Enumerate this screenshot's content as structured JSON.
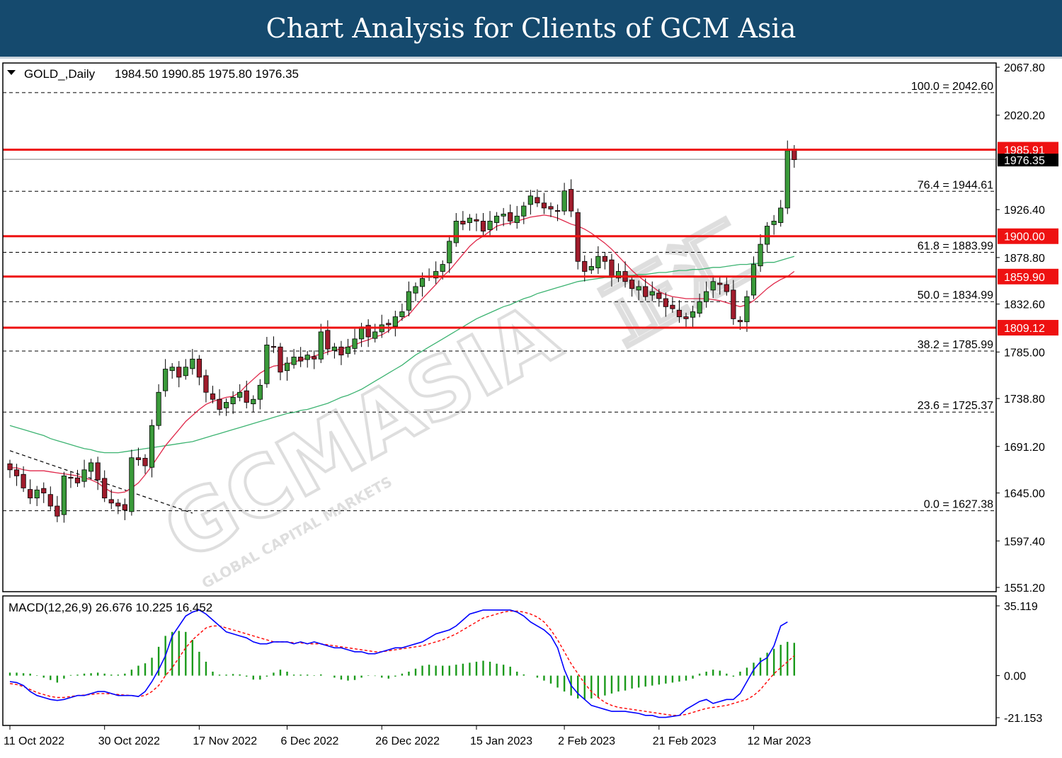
{
  "banner": {
    "title": "Chart Analysis for Clients of GCM Asia"
  },
  "header": {
    "symbol": "GOLD_,Daily",
    "ohlc": "1984.50 1990.85 1975.80 1976.35"
  },
  "watermark": {
    "main": "GCMASIA",
    "cn": "正汇",
    "sub": "GLOBAL CAPITAL MARKETS"
  },
  "colors": {
    "up_candle": "#3a9a3a",
    "down_candle": "#a01c2c",
    "resistance": "#ee1111",
    "ma_fast": "#e0284a",
    "ma_slow": "#3cb371",
    "macd": "#0000ff",
    "signal": "#ff0000",
    "histogram": "#1a9a1a",
    "label_bg_red": "#ee1111",
    "label_bg_black": "#000000"
  },
  "chart_data": [
    {
      "type": "line",
      "subtype": "candlestick",
      "ylim": [
        1551.2,
        2067.8
      ],
      "yticks": [
        "2067.80",
        "2020.20",
        "1926.40",
        "1878.80",
        "1832.60",
        "1785.00",
        "1738.80",
        "1691.20",
        "1645.00",
        "1597.40",
        "1551.20"
      ],
      "x_ticks": [
        "11 Oct 2022",
        "30 Oct 2022",
        "17 Nov 2022",
        "6 Dec 2022",
        "26 Dec 2022",
        "15 Jan 2023",
        "2 Feb 2023",
        "21 Feb 2023",
        "12 Mar 2023"
      ],
      "x_tick_index": [
        0,
        14,
        28,
        41,
        55,
        69,
        82,
        96,
        110
      ],
      "current_price": "1976.35",
      "resistance_levels": [
        {
          "value": 1985.91,
          "label": "1985.91"
        },
        {
          "value": 1900.0,
          "label": "1900.00"
        },
        {
          "value": 1859.9,
          "label": "1859.90"
        },
        {
          "value": 1809.12,
          "label": "1809.12"
        }
      ],
      "fibonacci": [
        {
          "value": 2042.6,
          "label": "100.0 = 2042.60"
        },
        {
          "value": 1944.61,
          "label": "76.4 = 1944.61"
        },
        {
          "value": 1883.99,
          "label": "61.8 = 1883.99"
        },
        {
          "value": 1834.99,
          "label": "50.0 = 1834.99"
        },
        {
          "value": 1785.99,
          "label": "38.2 = 1785.99"
        },
        {
          "value": 1725.37,
          "label": "23.6 = 1725.37"
        },
        {
          "value": 1627.38,
          "label": "0.0 = 1627.38"
        }
      ],
      "trendline": [
        [
          0,
          1687
        ],
        [
          27,
          1625
        ]
      ],
      "close": [
        1668,
        1662,
        1650,
        1640,
        1648,
        1645,
        1632,
        1622,
        1662,
        1660,
        1655,
        1668,
        1675,
        1658,
        1640,
        1635,
        1632,
        1628,
        1680,
        1678,
        1672,
        1712,
        1745,
        1768,
        1770,
        1760,
        1770,
        1778,
        1760,
        1745,
        1738,
        1728,
        1735,
        1740,
        1745,
        1735,
        1738,
        1752,
        1792,
        1790,
        1765,
        1774,
        1780,
        1776,
        1782,
        1778,
        1805,
        1788,
        1790,
        1782,
        1790,
        1798,
        1810,
        1800,
        1805,
        1812,
        1812,
        1820,
        1825,
        1845,
        1850,
        1858,
        1860,
        1865,
        1872,
        1895,
        1915,
        1912,
        1918,
        1915,
        1905,
        1915,
        1920,
        1922,
        1915,
        1920,
        1930,
        1940,
        1933,
        1928,
        1927,
        1925,
        1945,
        1925,
        1875,
        1865,
        1870,
        1880,
        1875,
        1860,
        1865,
        1855,
        1848,
        1850,
        1840,
        1845,
        1838,
        1830,
        1828,
        1820,
        1818,
        1825,
        1835,
        1845,
        1855,
        1852,
        1845,
        1818,
        1815,
        1840,
        1872,
        1892,
        1910,
        1915,
        1928,
        1985,
        1976
      ],
      "ma_fast": [
        1670,
        1670,
        1668,
        1667,
        1667,
        1667,
        1666,
        1665,
        1664,
        1663,
        1662,
        1660,
        1658,
        1655,
        1650,
        1646,
        1645,
        1646,
        1650,
        1655,
        1663,
        1672,
        1682,
        1692,
        1700,
        1708,
        1716,
        1722,
        1728,
        1733,
        1736,
        1738,
        1740,
        1741,
        1745,
        1752,
        1758,
        1764,
        1768,
        1771,
        1772,
        1773,
        1775,
        1777,
        1779,
        1781,
        1783,
        1785,
        1787,
        1788,
        1790,
        1792,
        1795,
        1797,
        1800,
        1802,
        1806,
        1812,
        1818,
        1822,
        1830,
        1838,
        1845,
        1852,
        1860,
        1866,
        1874,
        1882,
        1890,
        1896,
        1900,
        1905,
        1910,
        1912,
        1913,
        1915,
        1917,
        1919,
        1920,
        1921,
        1920,
        1918,
        1915,
        1912,
        1910,
        1907,
        1903,
        1898,
        1893,
        1887,
        1880,
        1873,
        1866,
        1860,
        1855,
        1850,
        1845,
        1842,
        1840,
        1839,
        1838,
        1838,
        1838,
        1838,
        1837,
        1836,
        1834,
        1832,
        1830,
        1832,
        1836,
        1842,
        1848,
        1853,
        1857,
        1860,
        1865
      ],
      "ma_slow": [
        1712,
        1710,
        1708,
        1706,
        1704,
        1702,
        1699,
        1697,
        1695,
        1693,
        1691,
        1689,
        1688,
        1686,
        1685,
        1685,
        1685,
        1686,
        1687,
        1688,
        1689,
        1690,
        1691,
        1692,
        1693,
        1694,
        1695,
        1696,
        1698,
        1700,
        1702,
        1704,
        1706,
        1708,
        1710,
        1712,
        1714,
        1716,
        1718,
        1720,
        1722,
        1724,
        1725,
        1727,
        1728,
        1730,
        1732,
        1734,
        1737,
        1740,
        1742,
        1745,
        1748,
        1752,
        1756,
        1760,
        1764,
        1768,
        1772,
        1777,
        1782,
        1786,
        1790,
        1794,
        1798,
        1802,
        1806,
        1810,
        1814,
        1818,
        1821,
        1824,
        1827,
        1830,
        1832,
        1835,
        1838,
        1840,
        1843,
        1845,
        1847,
        1849,
        1851,
        1853,
        1855,
        1856,
        1857,
        1858,
        1859,
        1859,
        1860,
        1861,
        1861,
        1862,
        1862,
        1863,
        1864,
        1864,
        1865,
        1866,
        1866,
        1867,
        1867,
        1868,
        1869,
        1869,
        1870,
        1871,
        1872,
        1872,
        1873,
        1873,
        1874,
        1874,
        1876,
        1878,
        1880
      ]
    },
    {
      "type": "line",
      "title": "MACD(12,26,9) 26.676 10.225 16.452",
      "ylim": [
        -21.153,
        35.119
      ],
      "yticks": [
        "35.119",
        "0.00",
        "-21.153"
      ],
      "histogram": [
        1.5,
        1.5,
        1.2,
        1.0,
        0.2,
        -1.0,
        -2.2,
        -3.5,
        -1.5,
        0.3,
        0.5,
        1.0,
        1.2,
        1.5,
        1.0,
        0.5,
        0.5,
        1.0,
        3.0,
        5.0,
        6.2,
        9.0,
        14.5,
        20.0,
        22.0,
        22.5,
        22.0,
        18.0,
        12.0,
        7.0,
        2.0,
        0.5,
        0.5,
        0.8,
        0.6,
        -0.5,
        -2.0,
        -2.0,
        -0.5,
        1.5,
        3.0,
        2.0,
        0.5,
        0.5,
        0.5,
        0.2,
        0.6,
        0.0,
        -1.0,
        -2.0,
        -2.5,
        -2.2,
        -1.0,
        0.2,
        -0.2,
        -1.0,
        -1.5,
        -0.5,
        1.0,
        2.0,
        3.5,
        5.0,
        5.5,
        5.0,
        5.0,
        5.0,
        5.5,
        6.0,
        6.5,
        7.0,
        7.5,
        7.0,
        6.0,
        5.5,
        4.5,
        2.0,
        0.6,
        0.0,
        -1.0,
        -2.5,
        -4.0,
        -6.0,
        -8.0,
        -10.0,
        -11.5,
        -12.0,
        -11.5,
        -11.0,
        -10.0,
        -9.0,
        -8.0,
        -7.5,
        -6.5,
        -6.0,
        -5.5,
        -5.0,
        -4.5,
        -4.0,
        -3.5,
        -3.0,
        -2.5,
        -1.5,
        1.0,
        2.0,
        3.0,
        2.5,
        1.0,
        -0.5,
        2.0,
        4.0,
        6.5,
        9.0,
        11.5,
        13.5,
        15.5,
        17.0,
        16.5
      ],
      "macd": [
        -3,
        -3.5,
        -5,
        -8,
        -10,
        -11,
        -12,
        -12.5,
        -12,
        -11,
        -10,
        -10,
        -9,
        -8,
        -8,
        -9,
        -10,
        -10,
        -10,
        -10.5,
        -8,
        -3,
        3,
        10,
        20,
        25,
        30,
        32,
        33,
        31,
        28,
        25,
        22,
        21,
        20,
        19,
        17,
        16,
        16,
        17,
        17,
        17,
        16,
        17,
        16,
        17,
        16,
        15,
        14,
        14,
        13,
        12,
        12,
        11,
        11,
        12,
        13,
        14,
        14,
        15,
        16,
        17,
        19,
        21,
        22,
        23,
        25,
        28,
        31,
        32,
        33,
        33,
        33,
        33,
        33,
        32,
        30,
        27,
        25,
        23,
        20,
        14,
        3,
        -5,
        -9,
        -12,
        -15,
        -16,
        -17,
        -18,
        -18,
        -18,
        -18.5,
        -19,
        -20,
        -20,
        -21,
        -21,
        -20.5,
        -20,
        -17,
        -15,
        -13,
        -12,
        -14,
        -13,
        -12,
        -12,
        -9,
        -3,
        3,
        7,
        9,
        15,
        25,
        27
      ],
      "signal": [
        -4,
        -4.5,
        -5.5,
        -7,
        -8.5,
        -9.5,
        -10.5,
        -11,
        -11,
        -10.5,
        -10,
        -9.8,
        -9.5,
        -9,
        -9,
        -9.2,
        -9.5,
        -9.8,
        -10,
        -10.5,
        -10,
        -8,
        -5,
        0,
        4,
        9,
        14,
        18,
        21,
        24,
        25,
        25,
        24,
        23,
        22,
        21,
        20,
        19,
        18,
        17,
        17,
        17,
        16.5,
        16.5,
        16,
        16,
        16,
        15.5,
        15,
        14.5,
        14,
        13.5,
        13,
        12.5,
        12,
        12,
        12.5,
        13,
        13.5,
        14,
        14.5,
        15,
        16,
        17,
        18,
        19.5,
        21,
        23,
        25,
        27,
        29,
        30,
        31,
        32,
        32.5,
        32.5,
        32,
        31,
        29.5,
        27,
        23,
        18,
        12,
        6,
        1,
        -4,
        -8,
        -11,
        -13.5,
        -15,
        -16,
        -16.5,
        -17,
        -17.5,
        -18,
        -18.5,
        -19,
        -19.5,
        -20,
        -20,
        -19.5,
        -18.5,
        -17.5,
        -16.5,
        -16,
        -15.5,
        -15,
        -14,
        -13,
        -12,
        -10,
        -7,
        -3,
        1,
        4,
        7,
        10
      ]
    }
  ]
}
